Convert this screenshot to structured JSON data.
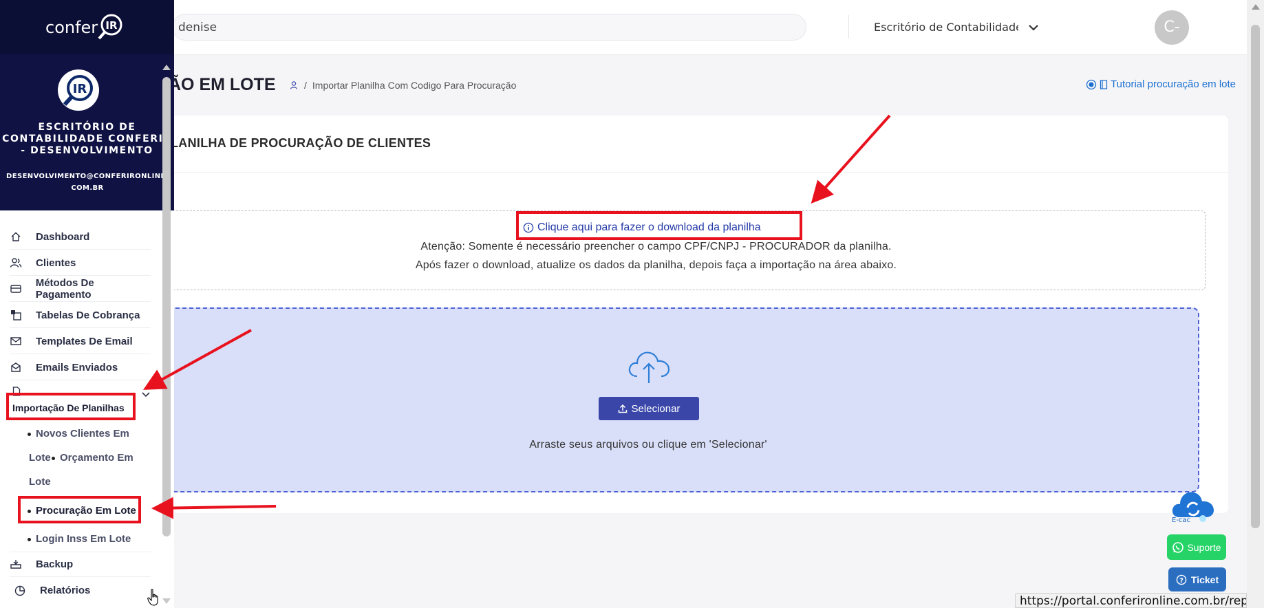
{
  "topbar": {
    "search_value": "denise",
    "company_select": "Escritório de Contabilidade Conferir - Desenvolvimento",
    "avatar_initials": "C-"
  },
  "page": {
    "title": "ÃO EM LOTE",
    "breadcrumb": "Importar Planilha Com Codigo Para Procuração",
    "tutorial_link": "Tutorial procuração em lote"
  },
  "card": {
    "title": "LANILHA DE PROCURAÇÃO DE CLIENTES",
    "download_link": "Clique aqui para fazer o download da planilha",
    "attention_text": "Atenção: Somente é necessário preencher o campo CPF/CNPJ - PROCURADOR da planilha.",
    "after_text": "Após fazer o download, atualize os dados da planilha, depois faça a importação na área abaixo.",
    "select_button": "Selecionar",
    "drag_text": "Arraste seus arquivos ou clique em 'Selecionar'"
  },
  "widgets": {
    "ecac_label": "E-cac",
    "support_label": "Suporte",
    "ticket_label": "Ticket",
    "url_tooltip": "https://portal.conferironline.com.br/reports"
  },
  "sidebar": {
    "logo_text": "confer",
    "logo_mark": "IR",
    "company_name": "ESCRITÓRIO DE CONTABILIDADE CONFERIR - DESENVOLVIMENTO",
    "company_email": "DESENVOLVIMENTO@CONFERIRONLINE.COM.BR",
    "items": [
      {
        "label": "Dashboard",
        "icon": "home-icon"
      },
      {
        "label": "Clientes",
        "icon": "users-icon"
      },
      {
        "label": "Métodos De Pagamento",
        "icon": "card-icon"
      },
      {
        "label": "Tabelas De Cobrança",
        "icon": "table-icon"
      },
      {
        "label": "Templates De Email",
        "icon": "mail-icon"
      },
      {
        "label": "Emails Enviados",
        "icon": "mail-sent-icon"
      },
      {
        "label": "Importação De Planilhas",
        "icon": "file-icon"
      },
      {
        "label": "Backup",
        "icon": "backup-icon"
      },
      {
        "label": "Relatórios",
        "icon": "pie-chart-icon"
      }
    ],
    "subitems": [
      {
        "label": "Novos Clientes Em"
      },
      {
        "label": "Lote"
      },
      {
        "label": "Orçamento Em"
      },
      {
        "label": "Lote"
      },
      {
        "label": "Procuração Em Lote"
      },
      {
        "label": "Login Inss Em Lote"
      }
    ]
  },
  "colors": {
    "annotation_red": "#e8121e",
    "sidebar_dark": "#0f1243",
    "primary": "#3a47a9",
    "dropzone": "#dadff9"
  }
}
